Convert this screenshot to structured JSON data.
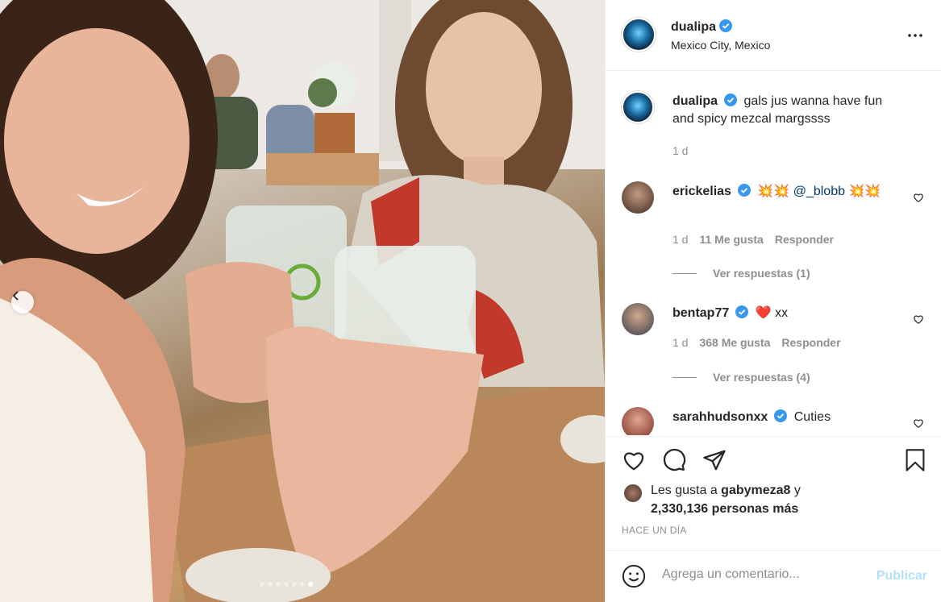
{
  "post": {
    "author": "dualipa",
    "location": "Mexico City, Mexico",
    "photo_carousel": {
      "total": 7,
      "active_index": 6
    }
  },
  "caption": {
    "username": "dualipa",
    "text": "gals jus wanna have fun and spicy mezcal margssss",
    "time": "1 d"
  },
  "comments": [
    {
      "username": "erickelias",
      "text_pre": "💥💥 ",
      "mention": "@_blobb",
      "text_post": " 💥💥",
      "time": "1 d",
      "likes": "11 Me gusta",
      "reply_label": "Responder",
      "view_replies": "Ver respuestas (1)"
    },
    {
      "username": "bentap77",
      "text": "❤️ xx",
      "time": "1 d",
      "likes": "368 Me gusta",
      "reply_label": "Responder",
      "view_replies": "Ver respuestas (4)"
    },
    {
      "username": "sarahhudsonxx",
      "text": "Cuties"
    }
  ],
  "likes": {
    "prefix": "Les gusta a ",
    "user": "gabymeza8",
    "connector": " y",
    "others": "2,330,136 personas más"
  },
  "timestamp": "HACE UN DÍA",
  "add_comment": {
    "placeholder": "Agrega un comentario...",
    "post_label": "Publicar"
  },
  "colors": {
    "verified": "#3897f0",
    "link": "#00376b",
    "muted": "#8e8e8e",
    "post_disabled": "#b2dffc"
  },
  "icons": [
    "more-options-icon",
    "verified-icon",
    "heart-icon",
    "comment-icon",
    "share-icon",
    "save-icon",
    "emoji-icon",
    "chevron-left-icon"
  ]
}
